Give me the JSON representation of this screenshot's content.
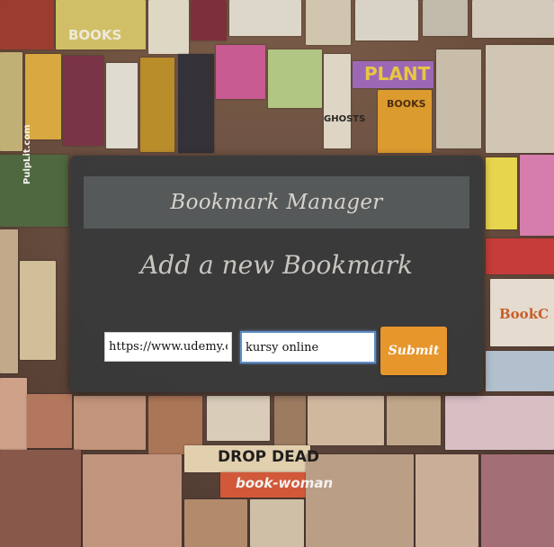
{
  "app": {
    "title": "Bookmark Manager"
  },
  "form": {
    "heading": "Add a new Bookmark",
    "url_value": "https://www.udemy.com",
    "name_value": "kursy online",
    "submit_label": "Submit"
  },
  "background": {
    "visible_texts": [
      "BOOKS",
      "BOOKS",
      "PLANT",
      "GHOSTS",
      "DROP DEAD",
      "book-woman",
      "BookC",
      "PulpLit.com"
    ]
  },
  "colors": {
    "panel": "#34383a",
    "header": "#6e7274",
    "accent": "#e7962c",
    "focus": "#5f8dc4"
  }
}
